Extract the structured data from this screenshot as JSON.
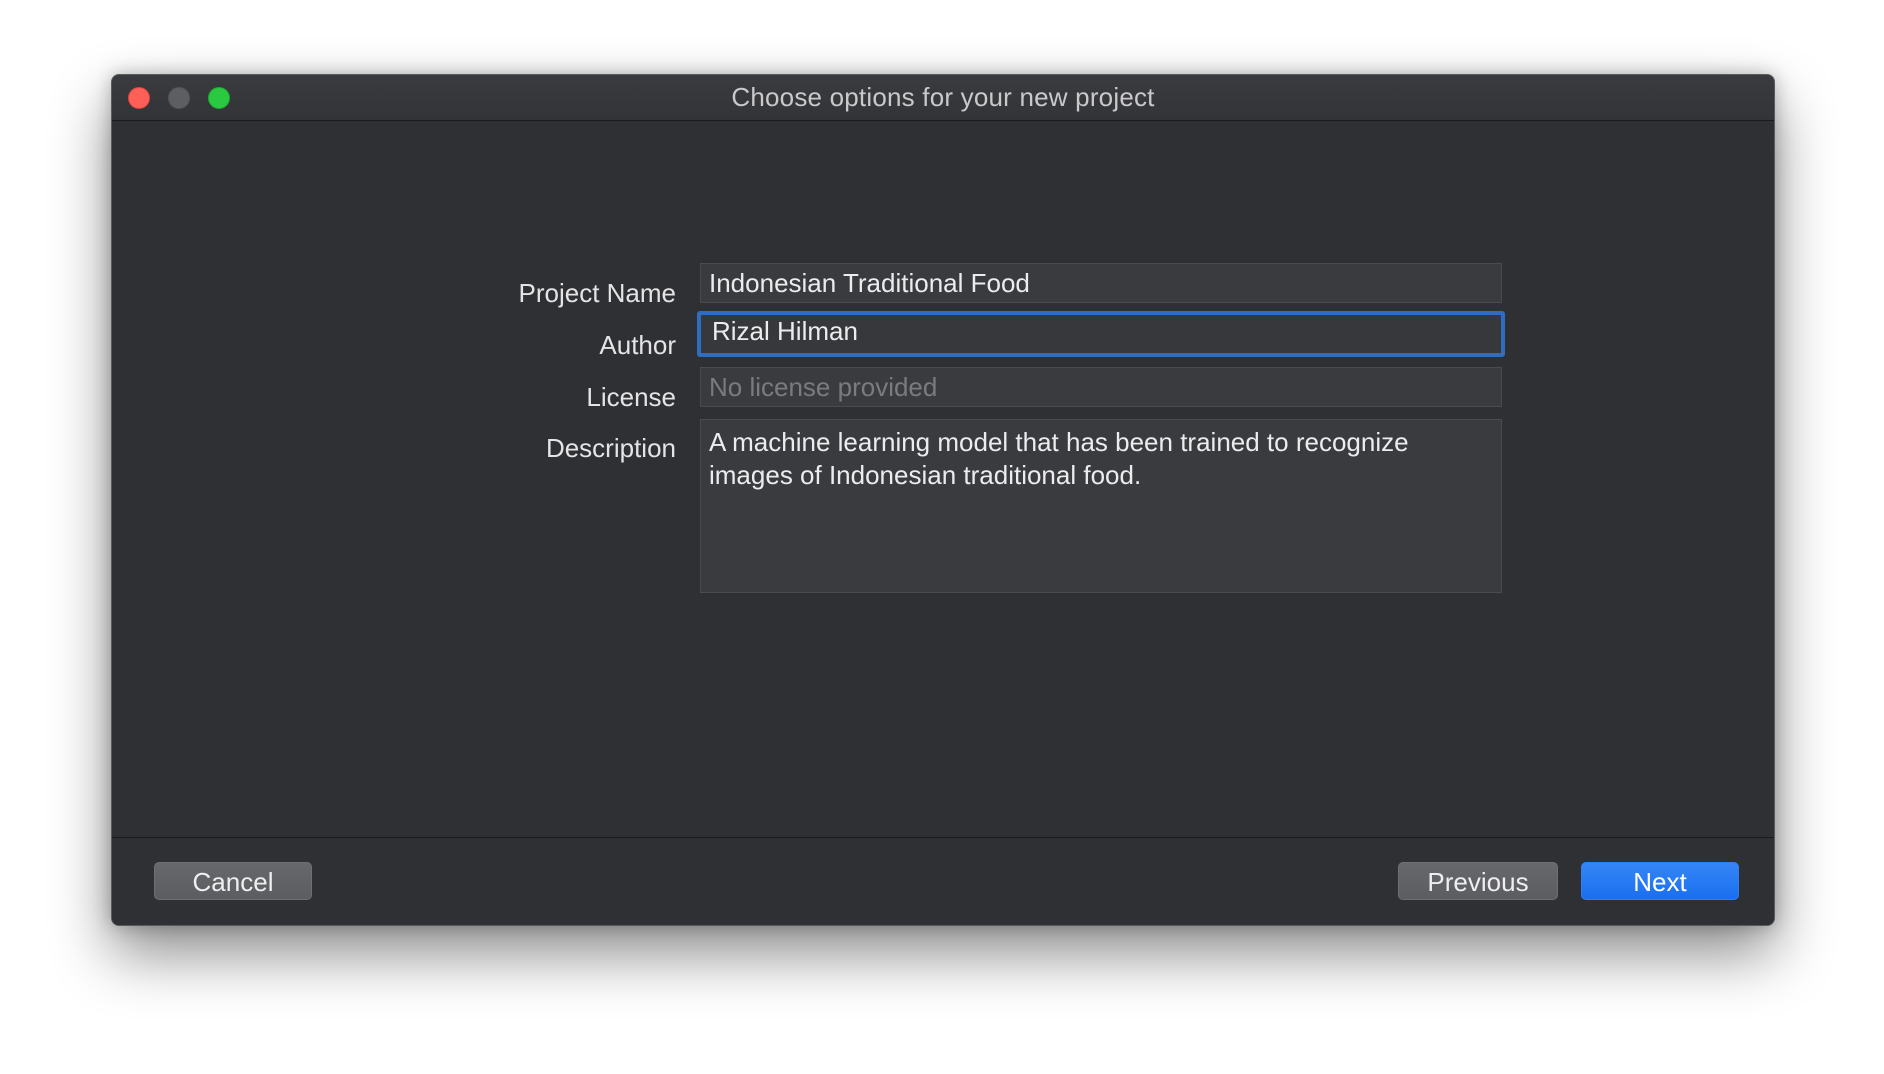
{
  "window": {
    "title": "Choose options for your new project"
  },
  "form": {
    "project_name": {
      "label": "Project Name",
      "value": "Indonesian Traditional Food"
    },
    "author": {
      "label": "Author",
      "value": "Rizal Hilman"
    },
    "license": {
      "label": "License",
      "value": "",
      "placeholder": "No license provided"
    },
    "description": {
      "label": "Description",
      "value": "A machine learning model that has been trained to recognize\nimages of Indonesian traditional food."
    }
  },
  "footer": {
    "cancel_label": "Cancel",
    "previous_label": "Previous",
    "next_label": "Next"
  },
  "colors": {
    "accent": "#1a6ff0",
    "focus_ring": "#2d6ec0",
    "window_bg": "#2f3033",
    "close": "#fe5f57",
    "minimize": "#5d5e61",
    "zoom": "#29c940"
  }
}
